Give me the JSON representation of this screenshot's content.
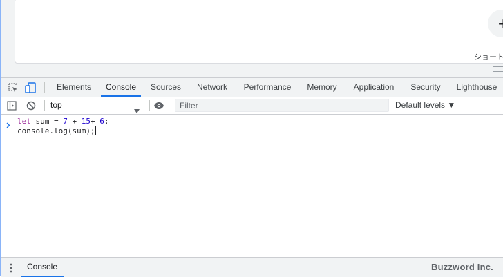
{
  "page": {
    "plus_glyph": "+",
    "shortcut_label": "ショート"
  },
  "devtools": {
    "tabs": [
      {
        "label": "Elements",
        "active": false
      },
      {
        "label": "Console",
        "active": true
      },
      {
        "label": "Sources",
        "active": false
      },
      {
        "label": "Network",
        "active": false
      },
      {
        "label": "Performance",
        "active": false
      },
      {
        "label": "Memory",
        "active": false
      },
      {
        "label": "Application",
        "active": false
      },
      {
        "label": "Security",
        "active": false
      },
      {
        "label": "Lighthouse",
        "active": false
      }
    ],
    "icons": {
      "inspect": "inspect-element-icon",
      "device": "device-toolbar-icon",
      "sidebar": "console-sidebar-icon",
      "clear": "clear-console-icon",
      "live_expression": "eye-icon"
    }
  },
  "console_toolbar": {
    "context": "top",
    "filter_placeholder": "Filter",
    "levels": "Default levels ▼"
  },
  "console": {
    "input_lines": [
      {
        "tokens": [
          {
            "text": "let",
            "kind": "kw"
          },
          {
            "text": " sum = ",
            "kind": "plain"
          },
          {
            "text": "7",
            "kind": "num"
          },
          {
            "text": " + ",
            "kind": "plain"
          },
          {
            "text": "15",
            "kind": "num"
          },
          {
            "text": "+ ",
            "kind": "plain"
          },
          {
            "text": "6",
            "kind": "num"
          },
          {
            "text": ";",
            "kind": "plain"
          }
        ]
      },
      {
        "tokens": [
          {
            "text": "console.log(sum);",
            "kind": "plain"
          }
        ]
      }
    ]
  },
  "drawer": {
    "tab_label": "Console",
    "watermark": "Buzzword Inc."
  },
  "colors": {
    "accent": "#1a73e8",
    "keyword": "#9a2a9a",
    "number": "#1c00cf"
  }
}
